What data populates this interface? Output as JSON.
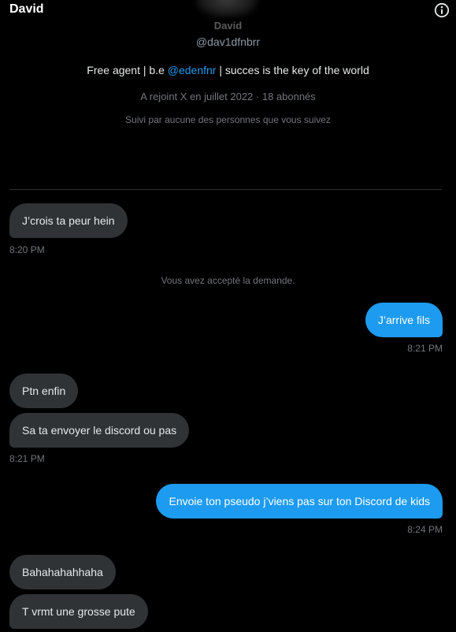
{
  "header": {
    "title": "David"
  },
  "profile": {
    "name": "David",
    "handle": "@dav1dfnbrr",
    "bio_before": "Free agent | b.e ",
    "bio_mention": "@edenfnr",
    "bio_after": " | succes is the key of the world",
    "joined": "A rejoint X en juillet 2022 · 18 abonnés",
    "followed_by": "Suivi par aucune des personnes que vous suivez"
  },
  "conversation": {
    "system_message": "Vous avez accepté la demande.",
    "messages": [
      {
        "text": "J’crois ta peur hein",
        "direction": "incoming"
      },
      {
        "text": "J’arrive fils",
        "direction": "outgoing"
      },
      {
        "text": "Ptn enfin",
        "direction": "incoming"
      },
      {
        "text": "Sa ta envoyer le discord ou pas",
        "direction": "incoming"
      },
      {
        "text": "Envoie ton pseudo j’viens pas sur ton Discord de kids",
        "direction": "outgoing"
      },
      {
        "text": "Bahahahahhaha",
        "direction": "incoming"
      },
      {
        "text": "T vrmt une grosse pute",
        "direction": "incoming"
      }
    ],
    "timestamps": [
      "8:20 PM",
      "8:21 PM",
      "8:21 PM",
      "8:24 PM"
    ]
  },
  "colors": {
    "background": "#000000",
    "accent": "#1d9bf0",
    "incoming_bubble": "#2f3336",
    "muted_text": "#71767b"
  },
  "icons": {
    "info": "info-circle-icon"
  }
}
